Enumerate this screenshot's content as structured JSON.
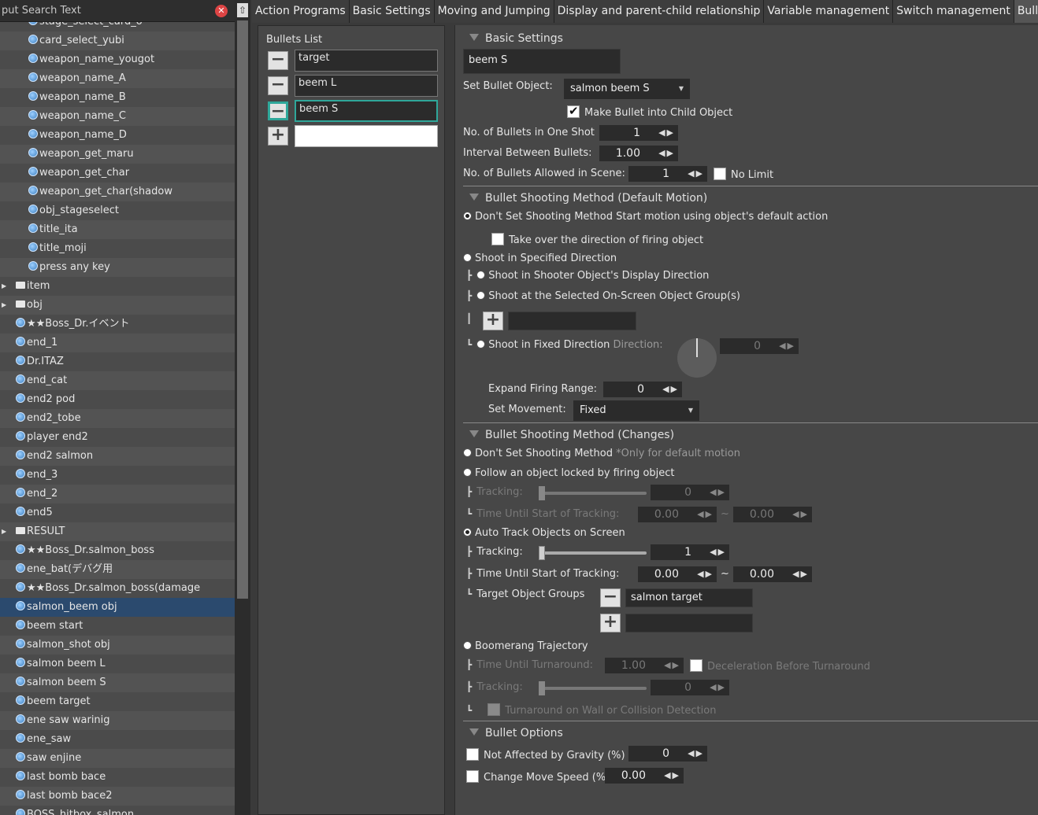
{
  "search": {
    "text": "put Search Text"
  },
  "tree": [
    {
      "label": "stage_select_card_o",
      "kind": "obj",
      "indent": 36
    },
    {
      "label": "card_select_yubi",
      "kind": "obj",
      "indent": 36
    },
    {
      "label": "weapon_name_yougot",
      "kind": "obj",
      "indent": 36
    },
    {
      "label": "weapon_name_A",
      "kind": "obj",
      "indent": 36
    },
    {
      "label": "weapon_name_B",
      "kind": "obj",
      "indent": 36
    },
    {
      "label": "weapon_name_C",
      "kind": "obj",
      "indent": 36
    },
    {
      "label": "weapon_name_D",
      "kind": "obj",
      "indent": 36
    },
    {
      "label": "weapon_get_maru",
      "kind": "obj",
      "indent": 36
    },
    {
      "label": "weapon_get_char",
      "kind": "obj",
      "indent": 36
    },
    {
      "label": "weapon_get_char(shadow",
      "kind": "obj",
      "indent": 36
    },
    {
      "label": "obj_stageselect",
      "kind": "obj",
      "indent": 36
    },
    {
      "label": "title_ita",
      "kind": "obj",
      "indent": 36
    },
    {
      "label": "title_moji",
      "kind": "obj",
      "indent": 36
    },
    {
      "label": "press any key",
      "kind": "obj",
      "indent": 36
    },
    {
      "label": "item",
      "kind": "folder",
      "indent": 20
    },
    {
      "label": "obj",
      "kind": "folder",
      "indent": 20
    },
    {
      "label": "★★Boss_Dr.イベント",
      "kind": "obj",
      "indent": 20
    },
    {
      "label": "end_1",
      "kind": "obj",
      "indent": 20
    },
    {
      "label": "Dr.ITAZ",
      "kind": "obj",
      "indent": 20
    },
    {
      "label": "end_cat",
      "kind": "obj",
      "indent": 20
    },
    {
      "label": "end2 pod",
      "kind": "obj",
      "indent": 20
    },
    {
      "label": "end2_tobe",
      "kind": "obj",
      "indent": 20
    },
    {
      "label": "player end2",
      "kind": "obj",
      "indent": 20
    },
    {
      "label": "end2 salmon",
      "kind": "obj",
      "indent": 20
    },
    {
      "label": "end_3",
      "kind": "obj",
      "indent": 20
    },
    {
      "label": "end_2",
      "kind": "obj",
      "indent": 20
    },
    {
      "label": "end5",
      "kind": "obj",
      "indent": 20
    },
    {
      "label": "RESULT",
      "kind": "folder",
      "indent": 20
    },
    {
      "label": "★★Boss_Dr.salmon_boss",
      "kind": "obj",
      "indent": 20
    },
    {
      "label": "ene_bat(デバグ用",
      "kind": "obj",
      "indent": 20
    },
    {
      "label": "★★Boss_Dr.salmon_boss(damage",
      "kind": "obj",
      "indent": 20
    },
    {
      "label": "salmon_beem obj",
      "kind": "obj",
      "indent": 20,
      "selected": true
    },
    {
      "label": "beem start",
      "kind": "obj",
      "indent": 20
    },
    {
      "label": "salmon_shot obj",
      "kind": "obj",
      "indent": 20
    },
    {
      "label": "salmon beem L",
      "kind": "obj",
      "indent": 20
    },
    {
      "label": "salmon beem S",
      "kind": "obj",
      "indent": 20
    },
    {
      "label": "beem target",
      "kind": "obj",
      "indent": 20
    },
    {
      "label": "ene saw warinig",
      "kind": "obj",
      "indent": 20
    },
    {
      "label": "ene_saw",
      "kind": "obj",
      "indent": 20
    },
    {
      "label": "saw enjine",
      "kind": "obj",
      "indent": 20
    },
    {
      "label": "last bomb bace",
      "kind": "obj",
      "indent": 20
    },
    {
      "label": "last bomb bace2",
      "kind": "obj",
      "indent": 20
    },
    {
      "label": "BOSS_hitbox_salmon",
      "kind": "obj",
      "indent": 20
    }
  ],
  "tabs": [
    "Action Programs",
    "Basic Settings",
    "Moving and Jumping",
    "Display and parent-child relationship",
    "Variable management",
    "Switch management",
    "Bullet Settings"
  ],
  "active_tab": 6,
  "bullets_list": {
    "title": "Bullets List",
    "items": [
      "target",
      "beem L",
      "beem S"
    ],
    "selected": 2
  },
  "basic": {
    "section": "Basic Settings",
    "name": "beem S",
    "set_bullet_label": "Set Bullet Object:",
    "bullet_object": "salmon beem S",
    "child_label": "Make Bullet into Child Object",
    "child_checked": true,
    "n_shot_label": "No. of Bullets in One Shot",
    "n_shot": "1",
    "interval_label": "Interval Between Bullets:",
    "interval": "1.00",
    "allowed_label": "No. of Bullets Allowed in Scene:",
    "allowed": "1",
    "no_limit_label": "No Limit"
  },
  "default_motion": {
    "section": "Bullet Shooting Method (Default Motion)",
    "opt_none": "Don't Set Shooting Method",
    "opt_none_note": "Start motion using object's default action",
    "take_over": "Take over the direction of firing object",
    "opt_specified": "Shoot in Specified Direction",
    "opt_display": "Shoot in Shooter Object's Display Direction",
    "opt_group": "Shoot at the Selected On-Screen Object Group(s)",
    "opt_fixed": "Shoot in Fixed Direction",
    "direction_label": "Direction:",
    "direction": "0",
    "expand_label": "Expand Firing Range:",
    "expand": "0",
    "movement_label": "Set Movement:",
    "movement": "Fixed"
  },
  "changes": {
    "section": "Bullet Shooting Method (Changes)",
    "opt_none": "Don't Set Shooting Method",
    "opt_none_note": "*Only for default motion",
    "opt_follow": "Follow an object locked by firing object",
    "tracking_label": "Tracking:",
    "follow_tracking": "0",
    "time_label": "Time Until Start of Tracking:",
    "follow_time_a": "0.00",
    "follow_time_b": "0.00",
    "tilde": "~",
    "opt_auto": "Auto Track Objects on Screen",
    "auto_tracking": "1",
    "auto_time_a": "0.00",
    "auto_time_b": "0.00",
    "groups_label": "Target Object Groups",
    "group": "salmon target",
    "opt_boomerang": "Boomerang Trajectory",
    "turn_label": "Time Until Turnaround:",
    "turn": "1.00",
    "decel_label": "Deceleration Before Turnaround",
    "boom_tracking": "0",
    "wall_label": "Turnaround on Wall or Collision Detection"
  },
  "options": {
    "section": "Bullet Options",
    "gravity_label": "Not Affected by Gravity (%)",
    "gravity": "0",
    "speed_label": "Change Move Speed (%)",
    "speed": "0.00"
  }
}
